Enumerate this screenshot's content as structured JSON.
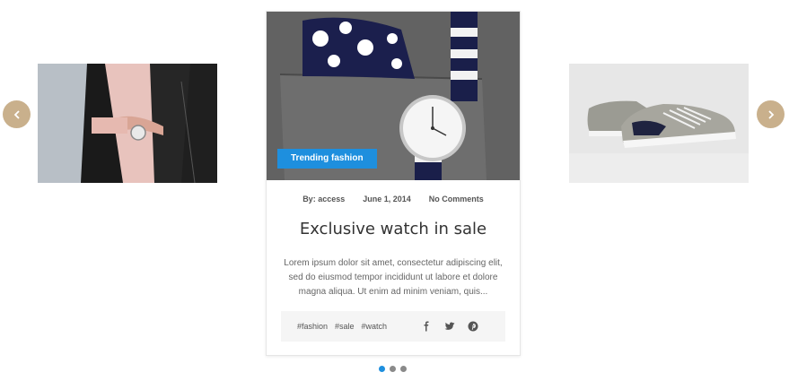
{
  "carousel": {
    "prev_icon": "chevron-left-icon",
    "next_icon": "chevron-right-icon",
    "accent_color": "#c9b08c",
    "pagination": {
      "count": 3,
      "active_index": 0,
      "active_color": "#1e8fde"
    }
  },
  "side_cards": {
    "left": {
      "image": "woman-leather-jacket-wristwatch-photo"
    },
    "right": {
      "image": "grey-sneakers-photo"
    }
  },
  "post": {
    "image": "polka-dot-pocket-square-and-watch-photo",
    "category": "Trending fashion",
    "category_color": "#1e8fde",
    "meta": {
      "author": "By: access",
      "date": "June 1, 2014",
      "comments": "No Comments"
    },
    "title": "Exclusive watch in sale",
    "excerpt": "Lorem ipsum dolor sit amet, consectetur adipiscing elit, sed do eiusmod tempor incididunt ut labore et dolore magna aliqua. Ut enim ad minim veniam, quis...",
    "tags": [
      "#fashion",
      "#sale",
      "#watch"
    ],
    "social": [
      "facebook-icon",
      "twitter-icon",
      "pinterest-icon"
    ]
  }
}
